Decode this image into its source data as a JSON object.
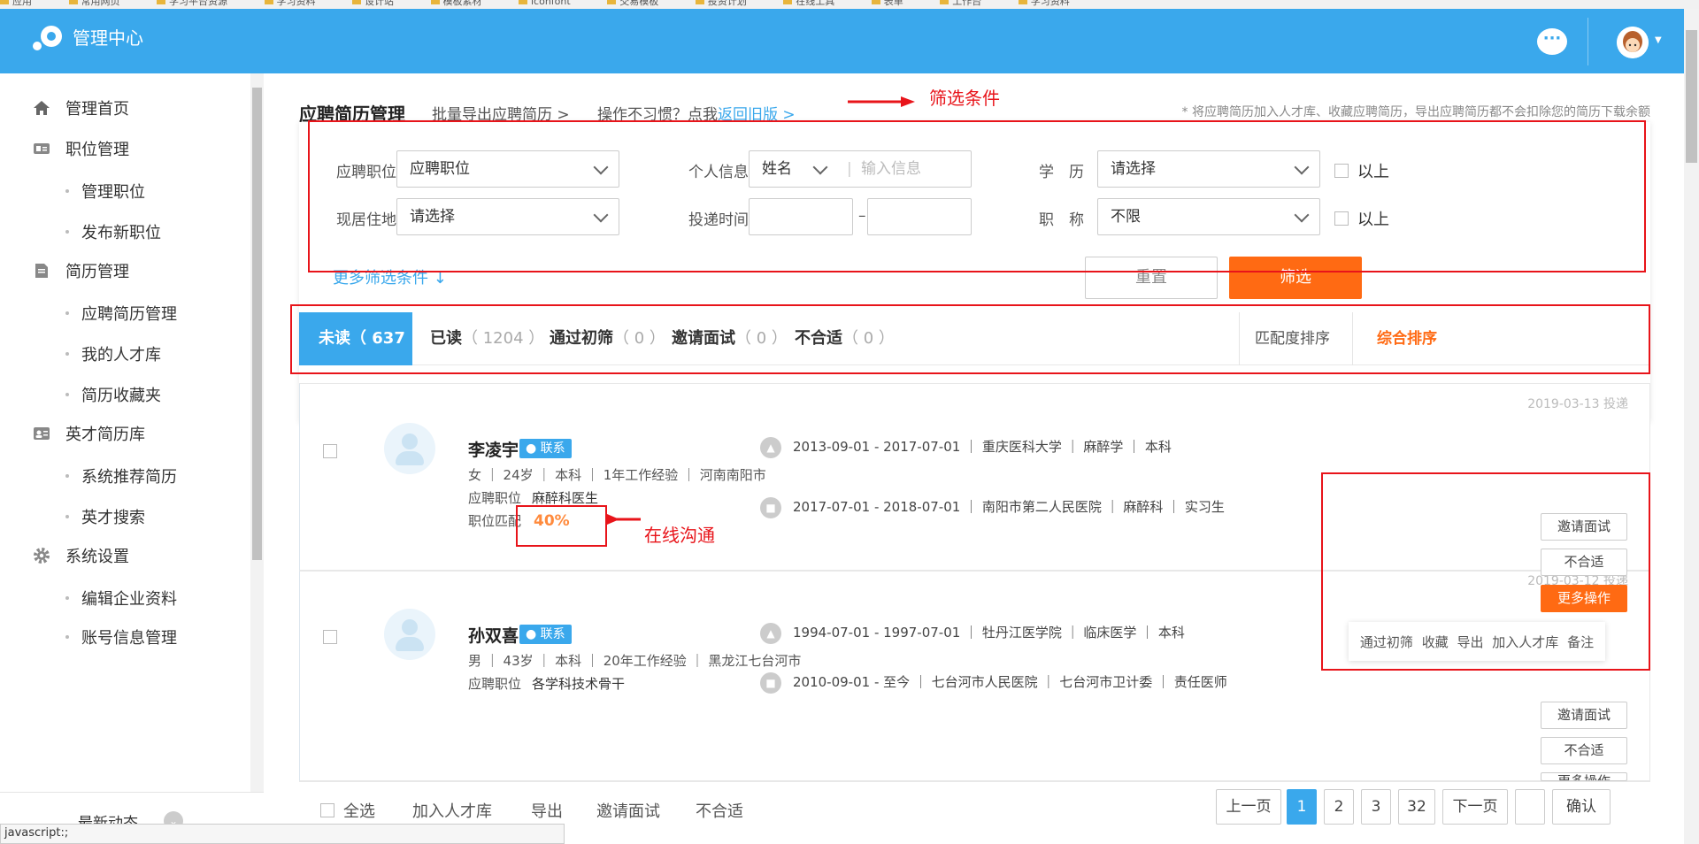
{
  "bookmarks": [
    "应用",
    "常用网页",
    "学习平台资源",
    "学习资料",
    "设计站",
    "模板素材",
    "iconfont",
    "交易模板",
    "投资计划",
    "在线工具",
    "表单",
    "工作台",
    "学习资料"
  ],
  "app": {
    "title": "管理中心",
    "chat_glyph": "···"
  },
  "colors": {
    "primary": "#3aa8ec",
    "accent": "#ff6a13",
    "annotation": "#e8141a"
  },
  "sidebar": {
    "groups": [
      {
        "icon": "home-icon",
        "label": "管理首页"
      },
      {
        "icon": "job-card-icon",
        "label": "职位管理"
      },
      {
        "icon": "document-icon",
        "label": "简历管理"
      },
      {
        "icon": "talent-card-icon",
        "label": "英才简历库"
      },
      {
        "icon": "gear-icon",
        "label": "系统设置"
      }
    ],
    "items": [
      "管理职位",
      "发布新职位",
      "应聘简历管理",
      "我的人才库",
      "简历收藏夹",
      "系统推荐简历",
      "英才搜索",
      "编辑企业资料",
      "账号信息管理"
    ],
    "latest": "最新动态",
    "status_url": "javascript:;"
  },
  "header": {
    "title": "应聘简历管理",
    "export": "批量导出应聘简历 >",
    "oldver_prefix": "操作不习惯？点我",
    "oldver_link": "返回旧版 >",
    "notice": "* 将应聘简历加入人才库、收藏应聘简历，导出应聘简历都不会扣除您的简历下载余额"
  },
  "annotations": {
    "filter": "筛选条件",
    "contact": "在线沟通"
  },
  "filters": {
    "position_label": "应聘职位",
    "position_value": "应聘职位",
    "personal_label": "个人信息",
    "personal_type": "姓名",
    "personal_placeholder": "输入信息",
    "edu_label": "学　历",
    "edu_value": "请选择",
    "edu_above": "以上",
    "residence_label": "现居住地",
    "residence_value": "请选择",
    "date_label": "投递时间",
    "date_sep": "–",
    "title_label": "职　称",
    "title_value": "不限",
    "title_above": "以上",
    "more": "更多筛选条件 ↓",
    "reset": "重置",
    "submit": "筛选"
  },
  "tabs": [
    {
      "label": "未读",
      "count": "（ 637 ）"
    },
    {
      "label": "已读",
      "count": "（ 1204 ）"
    },
    {
      "label": "通过初筛",
      "count": "（ 0 ）"
    },
    {
      "label": "邀请面试",
      "count": "（ 0 ）"
    },
    {
      "label": "不合适",
      "count": "（ 0 ）"
    }
  ],
  "sort": {
    "match": "匹配度排序",
    "overall": "综合排序"
  },
  "candidates": [
    {
      "name": "李凌宇",
      "contact": "联系",
      "meta": "女 ｜ 24岁 ｜ 本科 ｜ 1年工作经验 ｜ 河南南阳市",
      "pos_label": "应聘职位",
      "pos": "麻醉科医生",
      "match_label": "职位匹配",
      "match": "40%",
      "edu": "2013-09-01 - 2017-07-01 ｜ 重庆医科大学 ｜ 麻醉学 ｜ 本科",
      "work": "2017-07-01 - 2018-07-01 ｜ 南阳市第二人民医院 ｜ 麻醉科 ｜ 实习生",
      "date": "2019-03-13 投递"
    },
    {
      "name": "孙双喜",
      "contact": "联系",
      "meta": "男 ｜ 43岁 ｜ 本科 ｜ 20年工作经验 ｜ 黑龙江七台河市",
      "pos_label": "应聘职位",
      "pos": "各学科技术骨干",
      "edu": "1994-07-01 - 1997-07-01 ｜ 牡丹江医学院 ｜ 临床医学 ｜ 本科",
      "work": "2010-09-01 - 至今 ｜ 七台河市人民医院 ｜ 七台河市卫计委 ｜ 责任医师",
      "date": "2019-03-12 投递"
    }
  ],
  "actions": {
    "invite": "邀请面试",
    "reject": "不合适",
    "more": "更多操作"
  },
  "more_menu": [
    "通过初筛",
    "收藏",
    "导出",
    "加入人才库",
    "备注"
  ],
  "bottom": {
    "select_all": "全选",
    "add_pool": "加入人才库",
    "export": "导出",
    "invite": "邀请面试",
    "reject": "不合适",
    "prev": "上一页",
    "pages": [
      "1",
      "2",
      "3",
      "32"
    ],
    "next": "下一页",
    "confirm": "确认"
  }
}
